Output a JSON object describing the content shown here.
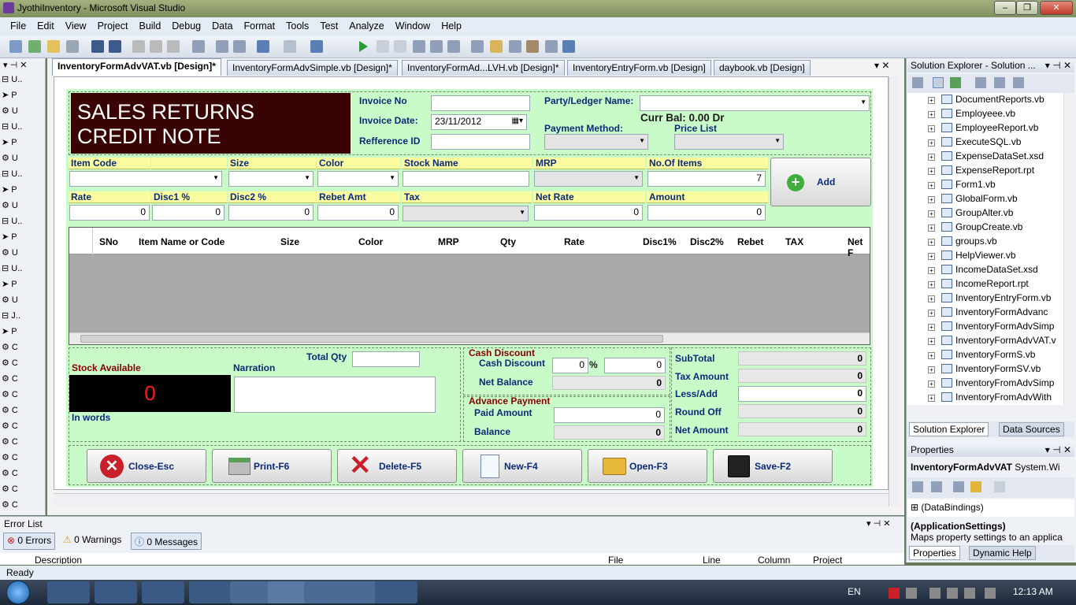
{
  "window": {
    "title": "JyothiInventory - Microsoft Visual Studio"
  },
  "menu": [
    "File",
    "Edit",
    "View",
    "Project",
    "Build",
    "Debug",
    "Data",
    "Format",
    "Tools",
    "Test",
    "Analyze",
    "Window",
    "Help"
  ],
  "tabs": [
    "InventoryFormAdvVAT.vb [Design]*",
    "InventoryFormAdvSimple.vb [Design]*",
    "InventoryFormAd...LVH.vb [Design]*",
    "InventoryEntryForm.vb [Design]",
    "daybook.vb [Design]"
  ],
  "form": {
    "title_line1": "SALES RETURNS",
    "title_line2": "CREDIT NOTE",
    "invoice_no_label": "Invoice No",
    "invoice_date_label": "Invoice Date:",
    "invoice_date_value": "23/11/2012",
    "reference_label": "Refference ID",
    "party_label": "Party/Ledger Name:",
    "curr_bal": "Curr Bal: 0.00 Dr",
    "payment_method_label": "Payment Method:",
    "price_list_label": "Price List",
    "item_code": "Item Code",
    "size": "Size",
    "color": "Color",
    "stock_name": "Stock Name",
    "mrp": "MRP",
    "no_items": "No.Of Items",
    "no_items_value": "7",
    "add": "Add",
    "rate": "Rate",
    "disc1": "Disc1 %",
    "disc2": "Disc2 %",
    "rebet": "Rebet Amt",
    "tax": "Tax",
    "net_rate": "Net Rate",
    "amount": "Amount",
    "zero": "0",
    "grid_cols": [
      "SNo",
      "Item Name or Code",
      "Size",
      "Color",
      "MRP",
      "Qty",
      "Rate",
      "Disc1%",
      "Disc2%",
      "Rebet",
      "TAX",
      "Net F"
    ],
    "stock_available": "Stock Available",
    "stock_value": "0",
    "in_words": "In words",
    "total_qty": "Total Qty",
    "narration": "Narration",
    "cash_discount_group": "Cash Discount",
    "cash_discount_label": "Cash Discount",
    "percent": "%",
    "net_balance": "Net Balance",
    "advance_payment": "Advance Payment",
    "paid_amount": "Paid Amount",
    "balance": "Balance",
    "subtotal": "SubTotal",
    "tax_amount": "Tax Amount",
    "less_add": "Less/Add",
    "round_off": "Round Off",
    "net_amount": "Net Amount",
    "buttons": [
      "Close-Esc",
      "Print-F6",
      "Delete-F5",
      "New-F4",
      "Open-F3",
      "Save-F2"
    ]
  },
  "solution_explorer": {
    "title": "Solution Explorer - Solution ...",
    "items": [
      "DocumentReports.vb",
      "Employeee.vb",
      "EmployeeReport.vb",
      "ExecuteSQL.vb",
      "ExpenseDataSet.xsd",
      "ExpenseReport.rpt",
      "Form1.vb",
      "GlobalForm.vb",
      "GroupAlter.vb",
      "GroupCreate.vb",
      "groups.vb",
      "HelpViewer.vb",
      "IncomeDataSet.xsd",
      "IncomeReport.rpt",
      "InventoryEntryForm.vb",
      "InventoryFormAdvanc",
      "InventoryFormAdvSimp",
      "InventoryFormAdvVAT.v",
      "InventoryFormS.vb",
      "InventoryFormSV.vb",
      "InventoryFromAdvSimp",
      "InventoryFromAdvWith"
    ],
    "tab1": "Solution Explorer",
    "tab2": "Data Sources"
  },
  "properties": {
    "title": "Properties",
    "object": "InventoryFormAdvVAT",
    "object_type": "System.Wi",
    "row1": "(DataBindings)",
    "row2": "(ApplicationSettings)",
    "row2_desc": "Maps property settings to an applica",
    "tab1": "Properties",
    "tab2": "Dynamic Help"
  },
  "errorlist": {
    "title": "Error List",
    "errors": "0 Errors",
    "warnings": "0 Warnings",
    "messages": "0 Messages",
    "cols": [
      "Description",
      "File",
      "Line",
      "Column",
      "Project"
    ]
  },
  "status": "Ready",
  "taskbar": {
    "lang": "EN",
    "time": "12:13 AM"
  },
  "colors": {
    "form_bg": "#c8fbc8",
    "title_bg": "#3a0303",
    "label_blue": "#0b2a7a",
    "stock_red": "#ff1a1a"
  }
}
